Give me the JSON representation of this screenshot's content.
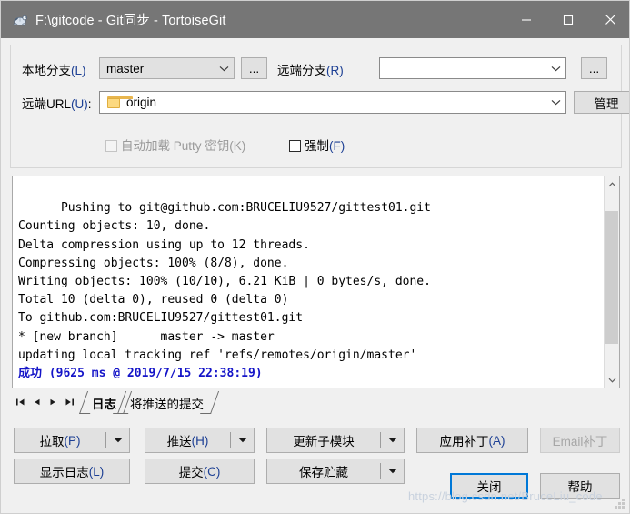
{
  "window": {
    "title": "F:\\gitcode - Git同步 - TortoiseGit",
    "icon": "tortoisegit-turtle-icon",
    "minimize_label": "minimize-icon",
    "maximize_label": "maximize-icon",
    "close_label": "close-icon"
  },
  "form": {
    "local_branch_label": "本地分支(L)",
    "local_branch_label_pre": "本地分支",
    "local_branch_label_acc": "(L)",
    "local_branch_value": "master",
    "local_branch_browse": "...",
    "remote_branch_label_pre": "远端分支",
    "remote_branch_label_acc": "(R)",
    "remote_branch_value": "",
    "remote_branch_browse": "...",
    "remote_url_label_pre": "远端URL",
    "remote_url_label_acc": "(U)",
    "remote_url_label_suffix": ":",
    "remote_url_value": "origin",
    "manage_button": "管理",
    "autoload_putty_pre": "自动加载 Putty 密钥",
    "autoload_putty_acc": "(K)",
    "autoload_putty_checked": false,
    "force_pre": "强制",
    "force_acc": "(F)",
    "force_checked": false
  },
  "log": {
    "lines": [
      "Pushing to git@github.com:BRUCELIU9527/gittest01.git",
      "Counting objects: 10, done.",
      "Delta compression using up to 12 threads.",
      "Compressing objects: 100% (8/8), done.",
      "Writing objects: 100% (10/10), 6.21 KiB | 0 bytes/s, done.",
      "Total 10 (delta 0), reused 0 (delta 0)",
      "To github.com:BRUCELIU9527/gittest01.git",
      "* [new branch]      master -> master",
      "updating local tracking ref 'refs/remotes/origin/master'",
      ""
    ],
    "success_line": "成功 (9625 ms @ 2019/7/15 22:38:19)",
    "success_color": "#1414c8"
  },
  "tabs": {
    "nav_first": "first-icon",
    "nav_prev": "prev-icon",
    "nav_next": "next-icon",
    "nav_last": "last-icon",
    "items": [
      {
        "label": "日志",
        "active": true
      },
      {
        "label": "将推送的提交",
        "active": false
      }
    ]
  },
  "buttons": {
    "pull_pre": "拉取",
    "pull_acc": "(P)",
    "push_pre": "推送",
    "push_acc": "(H)",
    "submodule_label": "更新子模块",
    "apply_patch_pre": "应用补丁",
    "apply_patch_acc": "(A)",
    "email_patch_label": "Email补丁",
    "email_patch_disabled": true,
    "show_log_pre": "显示日志",
    "show_log_acc": "(L)",
    "commit_pre": "提交",
    "commit_acc": "(C)",
    "stash_save_label": "保存贮藏",
    "close_label": "关闭",
    "help_label": "帮助"
  },
  "watermark": {
    "text": "https://blog.csdn.net/BruceLiu_code"
  }
}
